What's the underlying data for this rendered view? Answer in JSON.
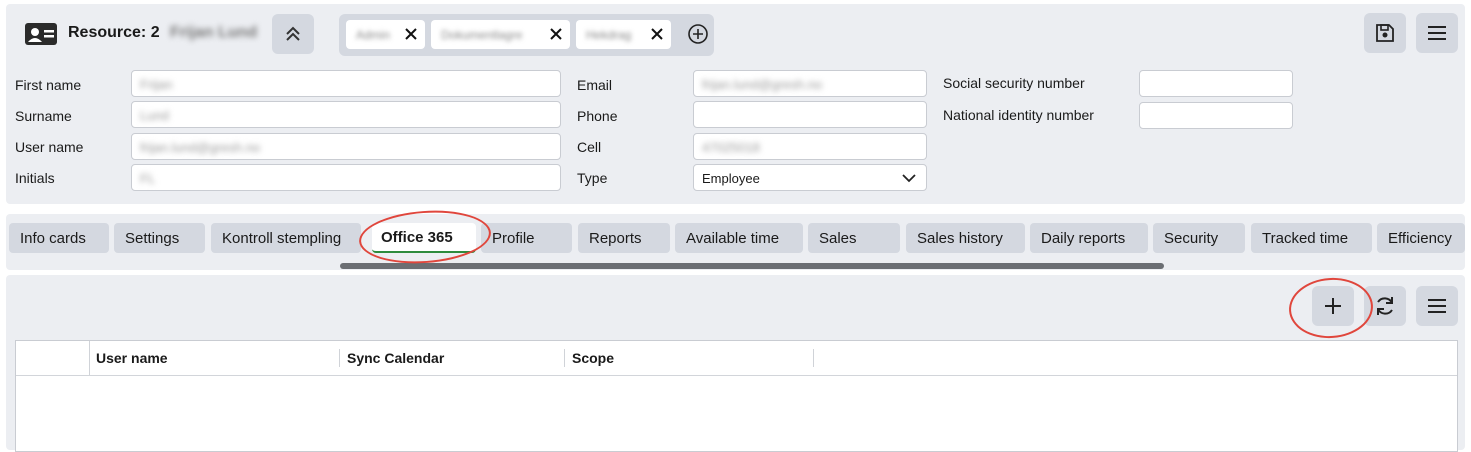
{
  "header": {
    "title": "Resource: 2",
    "name_redacted": "Frijan Lund",
    "chips": [
      {
        "label": "Admin"
      },
      {
        "label": "Dokumentlagre"
      },
      {
        "label": "Hekdrag"
      }
    ]
  },
  "form": {
    "first_name_label": "First name",
    "first_name_value": "Frijan",
    "surname_label": "Surname",
    "surname_value": "Lund",
    "username_label": "User name",
    "username_value": "frijan.lund@gresh.no",
    "initials_label": "Initials",
    "initials_value": "FL",
    "email_label": "Email",
    "email_value": "frijan.lund@gresh.no",
    "phone_label": "Phone",
    "phone_value": "",
    "cell_label": "Cell",
    "cell_value": "47025018",
    "type_label": "Type",
    "type_value": "Employee",
    "ssn_label": "Social security number",
    "ssn_value": "",
    "nin_label": "National identity number",
    "nin_value": ""
  },
  "tabs": [
    {
      "label": "Info cards"
    },
    {
      "label": "Settings"
    },
    {
      "label": "Kontroll stempling"
    },
    {
      "label": "Office 365",
      "active": true
    },
    {
      "label": "Profile"
    },
    {
      "label": "Reports"
    },
    {
      "label": "Available time"
    },
    {
      "label": "Sales"
    },
    {
      "label": "Sales history"
    },
    {
      "label": "Daily reports"
    },
    {
      "label": "Security"
    },
    {
      "label": "Tracked time"
    },
    {
      "label": "Efficiency"
    }
  ],
  "grid": {
    "columns": [
      "User name",
      "Sync Calendar",
      "Scope"
    ],
    "rows": []
  },
  "colors": {
    "panel": "#eceef2",
    "button": "#d4d8e0",
    "active_underline": "#2e8b3d",
    "annotation": "#e0463c"
  },
  "icons": {
    "resource": "id-card-icon",
    "collapse": "chevron-double-up-icon",
    "save": "save-icon",
    "menu": "hamburger-menu-icon",
    "add": "plus-icon",
    "refresh": "refresh-icon"
  }
}
